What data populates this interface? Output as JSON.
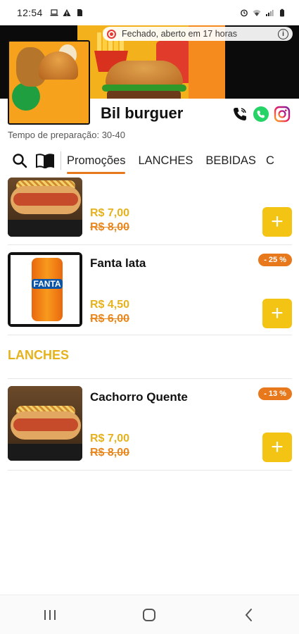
{
  "status_bar": {
    "time": "12:54"
  },
  "store": {
    "open_status": "Fechado, aberto em 17 horas",
    "name": "Bil burguer",
    "prep_time": "Tempo de preparação: 30-40"
  },
  "categories": {
    "tabs": [
      "Promoções",
      "LANCHES",
      "BEBIDAS",
      "C"
    ],
    "active_tab": "Promoções"
  },
  "products": [
    {
      "name": "",
      "price": "R$ 7,00",
      "old_price": "R$ 8,00",
      "image": "hot-dog",
      "badge": ""
    },
    {
      "name": "Fanta lata",
      "price": "R$ 4,50",
      "old_price": "R$ 6,00",
      "image": "fanta-can",
      "badge": "- 25 %"
    }
  ],
  "lanches_section": {
    "title": "LANCHES",
    "items": [
      {
        "name": "Cachorro Quente",
        "price": "R$ 7,00",
        "old_price": "R$ 8,00",
        "image": "hot-dog",
        "badge": "- 13 %"
      }
    ]
  },
  "colors": {
    "accent_orange": "#e7781c",
    "price_yellow": "#e6b21c",
    "add_button": "#f3c414",
    "closed_red": "#e53935"
  },
  "fanta_brand_label": "FANTA"
}
